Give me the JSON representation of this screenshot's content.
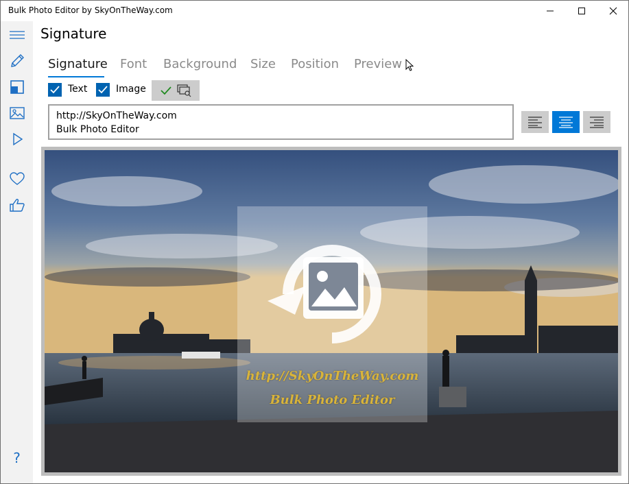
{
  "window": {
    "title": "Bulk Photo Editor by SkyOnTheWay.com"
  },
  "sidebar": {
    "items": [
      {
        "name": "menu",
        "icon": "hamburger-menu-icon"
      },
      {
        "name": "edit",
        "icon": "pencil-icon"
      },
      {
        "name": "resize",
        "icon": "crop-frame-icon"
      },
      {
        "name": "image",
        "icon": "image-icon"
      },
      {
        "name": "run",
        "icon": "play-icon"
      },
      {
        "name": "favorite",
        "icon": "heart-icon"
      },
      {
        "name": "like",
        "icon": "thumbs-up-icon"
      },
      {
        "name": "help",
        "icon": "help-question-icon",
        "label": "?"
      }
    ]
  },
  "page": {
    "title": "Signature"
  },
  "tabs": [
    {
      "label": "Signature",
      "active": true
    },
    {
      "label": "Font",
      "active": false
    },
    {
      "label": "Background",
      "active": false
    },
    {
      "label": "Size",
      "active": false
    },
    {
      "label": "Position",
      "active": false
    },
    {
      "label": "Preview",
      "active": false
    }
  ],
  "options": {
    "text_label": "Text",
    "text_checked": true,
    "image_label": "Image",
    "image_checked": true
  },
  "signature": {
    "line1": "http://SkyOnTheWay.com",
    "line2": "Bulk Photo Editor"
  },
  "alignment": {
    "options": [
      "left",
      "center",
      "right"
    ],
    "selected": "center"
  },
  "watermark": {
    "line1": "http://SkyOnTheWay.com",
    "line2": "Bulk Photo Editor",
    "color": "#d9b43a"
  },
  "colors": {
    "accent": "#0078d7",
    "checkbox": "#0063b1",
    "sidebar_bg": "#f2f2f2",
    "icon": "#1e6fc4"
  }
}
